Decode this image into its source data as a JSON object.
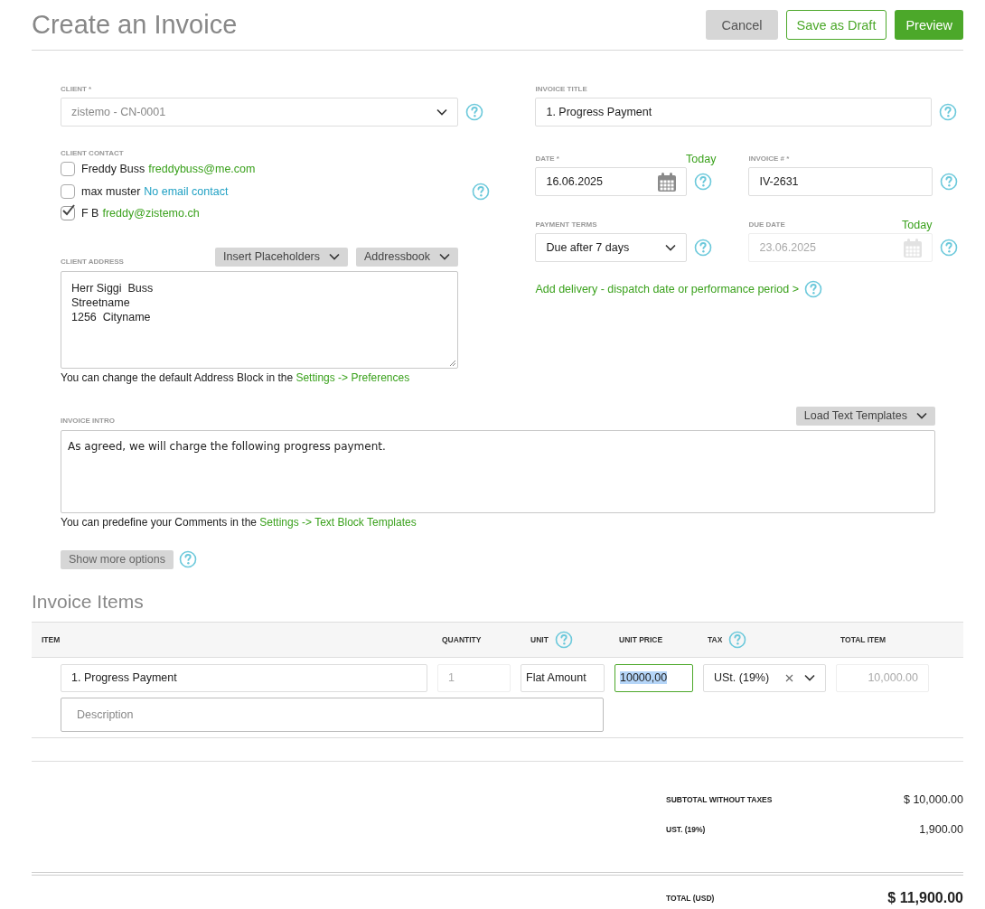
{
  "header": {
    "title": "Create an Invoice",
    "buttons": [
      {
        "label": "Cancel",
        "kind": "secondary"
      },
      {
        "label": "Save as Draft",
        "kind": "outline"
      },
      {
        "label": "Preview",
        "kind": "primary"
      }
    ]
  },
  "client": {
    "label": "CLIENT *",
    "value": "zistemo - CN-0001"
  },
  "client_contact": {
    "label": "CLIENT CONTACT",
    "contacts": [
      {
        "name": "Freddy Buss",
        "email": "freddybuss@me.com",
        "kind": "email",
        "checked": false
      },
      {
        "name": "max muster",
        "email": "No email contact",
        "kind": "none",
        "checked": false
      },
      {
        "name": "F B",
        "email": "freddy@zistemo.ch",
        "kind": "email",
        "checked": true
      }
    ]
  },
  "client_address": {
    "label": "CLIENT ADDRESS",
    "buttons": [
      "Insert Placeholders",
      "Addressbook"
    ],
    "lines": [
      "Herr Siggi  Buss",
      "Streetname",
      "1256  Cityname"
    ],
    "hint": "You can change the default Address Block in the",
    "hint_link": "Settings -> Preferences"
  },
  "invoice_title": {
    "label": "INVOICE TITLE",
    "value": "1. Progress Payment"
  },
  "date": {
    "label": "DATE *",
    "today": "Today",
    "value": "16.06.2025",
    "disabled": false
  },
  "invoice_number": {
    "label": "INVOICE # *",
    "value": "IV-2631"
  },
  "payment_terms": {
    "label": "PAYMENT TERMS",
    "value": "Due after 7 days"
  },
  "due_date": {
    "label": "DUE DATE",
    "today": "Today",
    "value": "23.06.2025",
    "disabled": true
  },
  "delivery_link": "Add delivery - dispatch date or performance period >",
  "intro": {
    "label": "INVOICE INTRO",
    "template_button": "Load Text Templates",
    "value": "As agreed, we will charge the following progress payment.",
    "hint": "You can predefine your Comments in the",
    "hint_link": "Settings -> Text Block Templates"
  },
  "more_options_button": "Show more options",
  "items": {
    "title": "Invoice Items",
    "columns": [
      {
        "label": "ITEM",
        "help": false
      },
      {
        "label": "QUANTITY",
        "help": false
      },
      {
        "label": "UNIT",
        "help": true
      },
      {
        "label": "UNIT PRICE",
        "help": false
      },
      {
        "label": "TAX",
        "help": true
      },
      {
        "label": "TOTAL ITEM",
        "help": false
      }
    ],
    "rows": [
      {
        "item": "1. Progress Payment",
        "quantity": "1",
        "unit": "Flat Amount",
        "unit_price": "10000,00",
        "unit_price_focused": true,
        "tax": "USt. (19%)",
        "total": "10,000.00",
        "description_placeholder": "Description"
      }
    ]
  },
  "totals": [
    {
      "label": "SUBTOTAL WITHOUT TAXES",
      "value": "$ 10,000.00"
    },
    {
      "label": "UST. (19%)",
      "value": "1,900.00"
    }
  ],
  "grand_total": {
    "label": "TOTAL (USD)",
    "value": "$ 11,900.00"
  }
}
